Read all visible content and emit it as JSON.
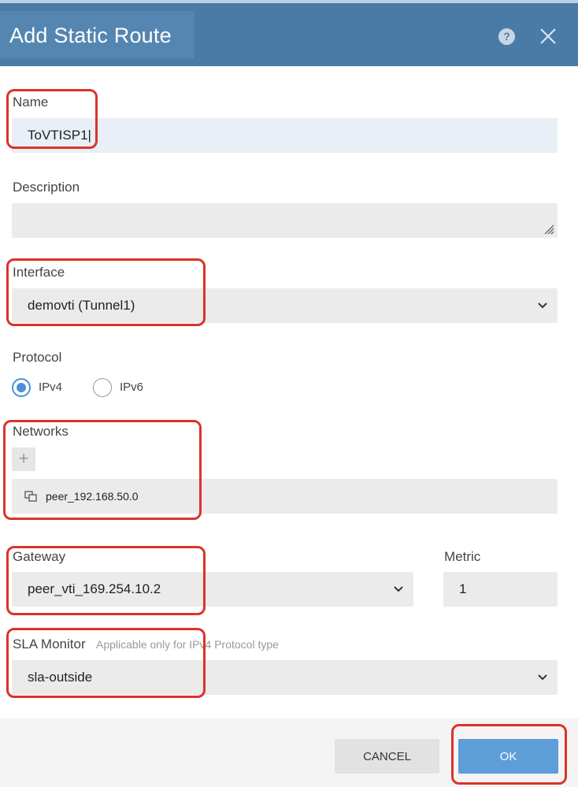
{
  "dialog": {
    "title": "Add Static Route",
    "help_icon": "?",
    "close_icon": "close-icon"
  },
  "form": {
    "name": {
      "label": "Name",
      "value": "ToVTISP1|"
    },
    "description": {
      "label": "Description",
      "value": ""
    },
    "interface": {
      "label": "Interface",
      "value": "demovti (Tunnel1)"
    },
    "protocol": {
      "label": "Protocol",
      "options": [
        {
          "label": "IPv4",
          "selected": true
        },
        {
          "label": "IPv6",
          "selected": false
        }
      ]
    },
    "networks": {
      "label": "Networks",
      "add_icon": "+",
      "items": [
        {
          "label": "peer_192.168.50.0",
          "icon": "network-object-icon"
        }
      ]
    },
    "gateway": {
      "label": "Gateway",
      "value": "peer_vti_169.254.10.2"
    },
    "metric": {
      "label": "Metric",
      "value": "1"
    },
    "sla_monitor": {
      "label": "SLA Monitor",
      "hint": "Applicable only for IPv4 Protocol type",
      "value": "sla-outside"
    }
  },
  "footer": {
    "cancel_label": "CANCEL",
    "ok_label": "OK"
  },
  "colors": {
    "header": "#4a7ba6",
    "accent": "#4a90d9",
    "ok_button": "#5d9dd8",
    "highlight": "#d9342b"
  }
}
